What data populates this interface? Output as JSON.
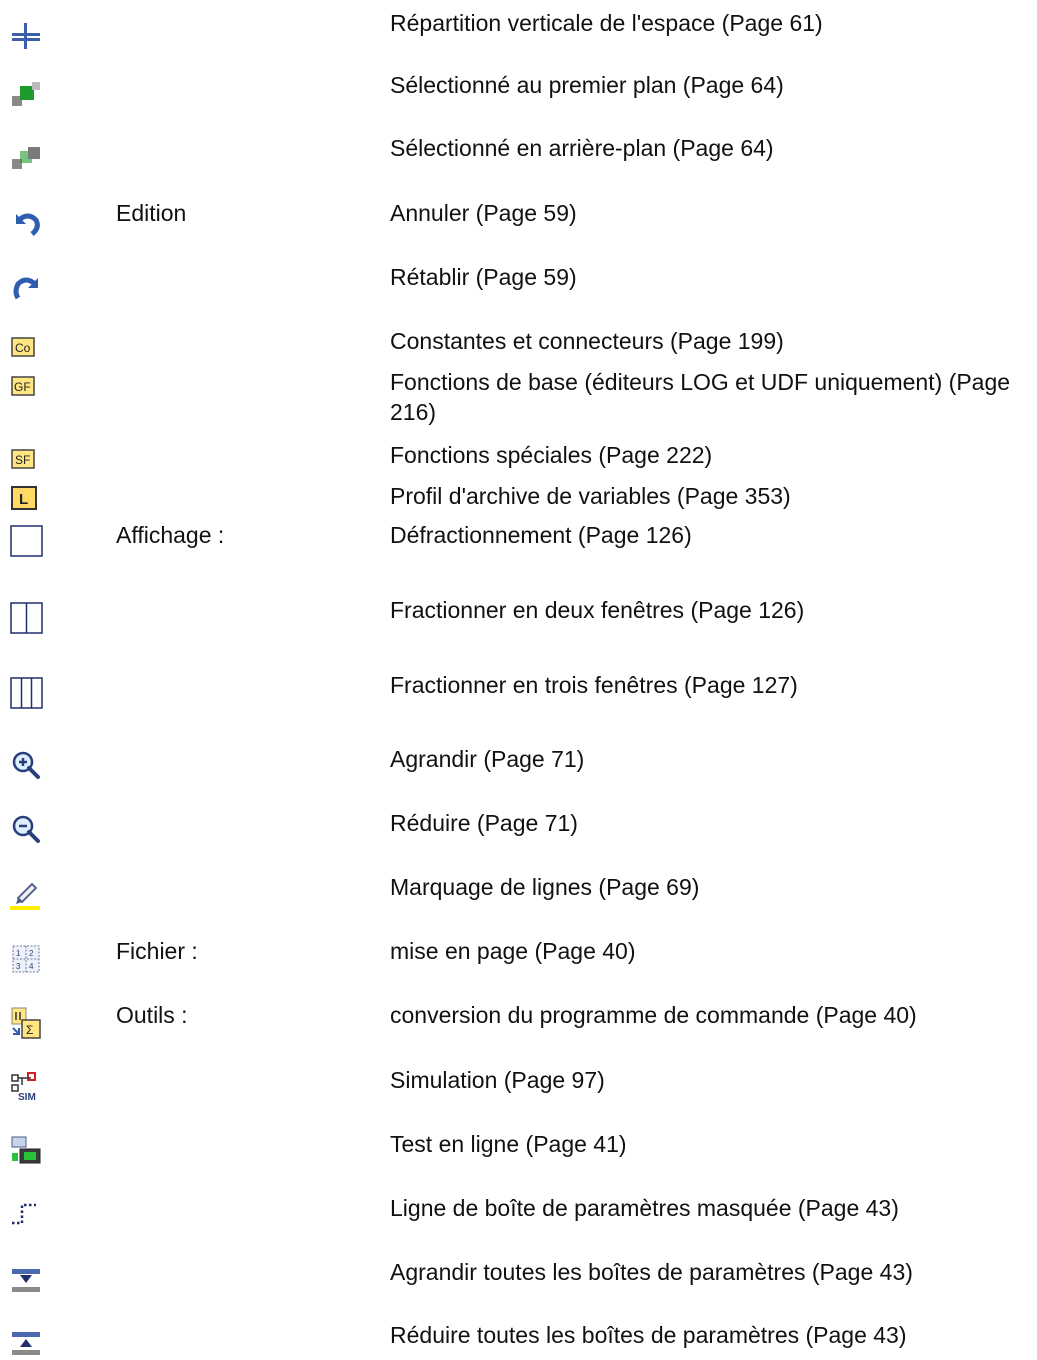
{
  "rows": [
    {
      "icon": "vertical-space-icon",
      "menu": "",
      "desc": "Répartition verticale de l'espace (Page 61)"
    },
    {
      "icon": "bring-to-front-icon",
      "menu": "",
      "desc": "Sélectionné au premier plan (Page 64)"
    },
    {
      "icon": "send-to-back-icon",
      "menu": "",
      "desc": "Sélectionné en arrière-plan (Page 64)"
    },
    {
      "icon": "undo-icon",
      "menu": "Edition",
      "desc": "Annuler (Page 59)"
    },
    {
      "icon": "redo-icon",
      "menu": "",
      "desc": "Rétablir (Page 59)"
    },
    {
      "icon": "co-block-icon",
      "menu": "",
      "desc": "Constantes et connecteurs (Page 199)"
    },
    {
      "icon": "gf-block-icon",
      "menu": "",
      "desc": "Fonctions de base (éditeurs LOG et UDF uniquement) (Page 216)"
    },
    {
      "icon": "sf-block-icon",
      "menu": "",
      "desc": "Fonctions spéciales (Page 222)"
    },
    {
      "icon": "l-block-icon",
      "menu": "",
      "desc": "Profil d'archive de variables (Page 353)"
    },
    {
      "icon": "single-window-icon",
      "menu": "Affichage :",
      "desc": "Défractionnement (Page 126)"
    },
    {
      "icon": "two-windows-icon",
      "menu": "",
      "desc": "Fractionner en deux fenêtres (Page 126)"
    },
    {
      "icon": "three-windows-icon",
      "menu": "",
      "desc": "Fractionner en trois fenêtres (Page 127)"
    },
    {
      "icon": "zoom-in-icon",
      "menu": "",
      "desc": "Agrandir (Page 71)"
    },
    {
      "icon": "zoom-out-icon",
      "menu": "",
      "desc": "Réduire (Page 71)"
    },
    {
      "icon": "highlighter-icon",
      "menu": "",
      "desc": "Marquage de lignes (Page 69)"
    },
    {
      "icon": "page-layout-icon",
      "menu": "Fichier :",
      "desc": "mise en page (Page 40)"
    },
    {
      "icon": "convert-program-icon",
      "menu": "Outils :",
      "desc": "conversion du programme de commande (Page 40)"
    },
    {
      "icon": "simulation-icon",
      "menu": "",
      "desc": "Simulation (Page 97)"
    },
    {
      "icon": "online-test-icon",
      "menu": "",
      "desc": "Test en ligne (Page 41)"
    },
    {
      "icon": "hidden-line-icon",
      "menu": "",
      "desc": "Ligne de boîte de paramètres masquée (Page 43)"
    },
    {
      "icon": "expand-boxes-icon",
      "menu": "",
      "desc": "Agrandir toutes les boîtes de paramètres (Page 43)"
    },
    {
      "icon": "collapse-boxes-icon",
      "menu": "",
      "desc": "Réduire toutes les boîtes de paramètres (Page 43)"
    }
  ]
}
